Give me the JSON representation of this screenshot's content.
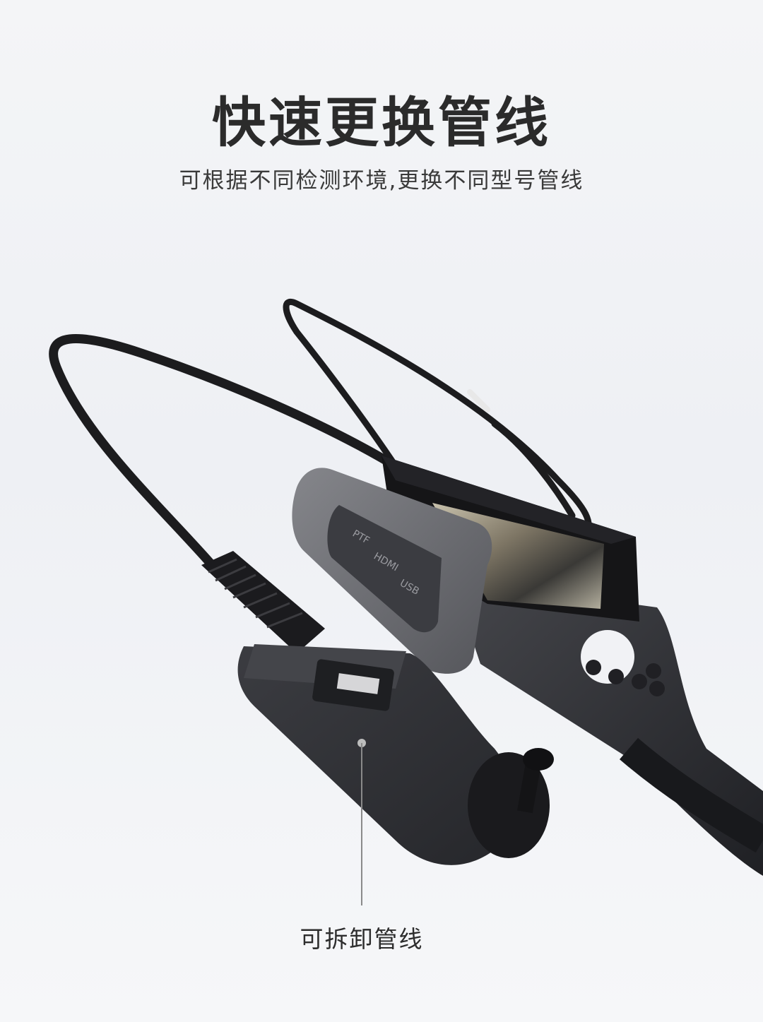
{
  "header": {
    "title": "快速更换管线",
    "subtitle": "可根据不同检测环境,更换不同型号管线"
  },
  "product": {
    "port_labels": [
      "PTF",
      "HDMI",
      "USB"
    ],
    "callout": "可拆卸管线"
  },
  "colors": {
    "title": "#2b2b2b",
    "body_dark": "#2e2f33",
    "rubber_gray": "#6a6b70",
    "cable": "#1c1c1e"
  }
}
